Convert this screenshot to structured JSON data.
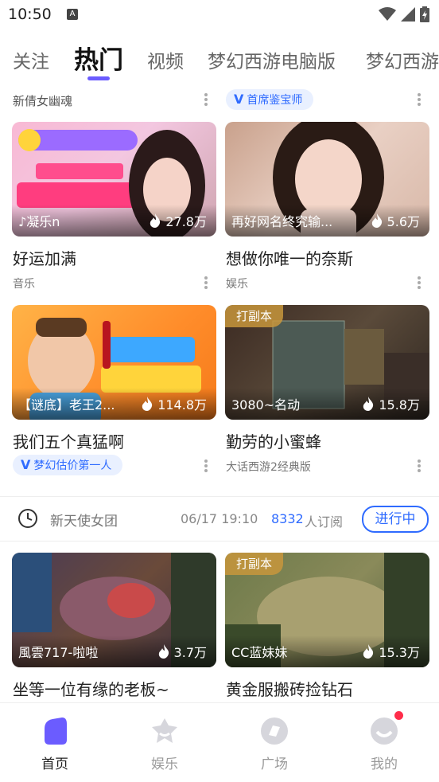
{
  "status_bar": {
    "time": "10:50",
    "notif": "A"
  },
  "tabs": [
    {
      "label": "关注"
    },
    {
      "label": "热门"
    },
    {
      "label": "视频"
    },
    {
      "label": "梦幻西游电脑版"
    },
    {
      "label": "梦幻西游"
    }
  ],
  "top_row": {
    "left_label": "新倩女幽魂",
    "right_badge": "首席鉴宝师",
    "badge_mark": "V"
  },
  "cards": [
    {
      "name": "♪凝乐n",
      "heat": "27.8万",
      "title": "好运加满",
      "sub": "音乐",
      "tag": ""
    },
    {
      "name": "再好网名终究输...",
      "heat": "5.6万",
      "title": "想做你唯一的奈斯",
      "sub": "娱乐",
      "tag": ""
    },
    {
      "name": "【谜底】老王2...",
      "heat": "114.8万",
      "title": "我们五个真猛啊",
      "sub": "梦幻估价第一人",
      "tag": ""
    },
    {
      "name": "3080~名动",
      "heat": "15.8万",
      "title": "勤劳的小蜜蜂",
      "sub": "大话西游2经典版",
      "tag": "打副本"
    },
    {
      "name": "風雲717-啦啦",
      "heat": "3.7万",
      "title": "坐等一位有缘的老板~",
      "sub": "",
      "tag": ""
    },
    {
      "name": "CC蓝妹妹",
      "heat": "15.3万",
      "title": "黄金服搬砖捡钻石",
      "sub": "",
      "tag": "打副本"
    }
  ],
  "schedule": {
    "name": "新天使女团",
    "time": "06/17 19:10",
    "count": "8332",
    "count_suffix": "人订阅",
    "status": "进行中"
  },
  "bottom_nav": [
    {
      "label": "首页"
    },
    {
      "label": "娱乐"
    },
    {
      "label": "广场"
    },
    {
      "label": "我的"
    }
  ],
  "colors": {
    "accent": "#6b5cff",
    "badge_blue": "#2f6bff",
    "notify_red": "#ff2d4a"
  },
  "icons": [
    "clock-icon",
    "flame-icon",
    "home-icon",
    "entertainment-icon",
    "plaza-icon",
    "profile-icon"
  ]
}
